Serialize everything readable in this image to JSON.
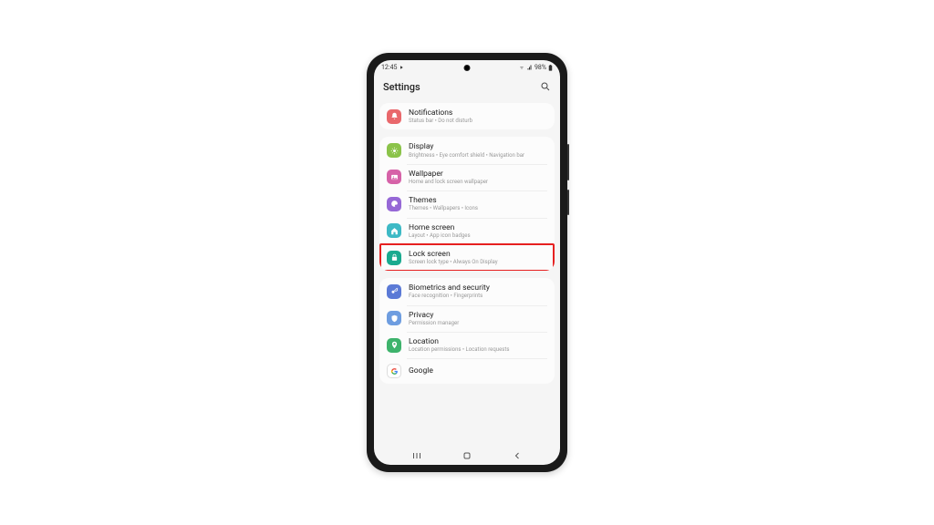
{
  "status": {
    "time": "12:45",
    "battery": "98%"
  },
  "header": {
    "title": "Settings"
  },
  "groups": [
    {
      "items": [
        {
          "id": "notifications",
          "title": "Notifications",
          "sub": "Status bar  •  Do not disturb",
          "icon": "bell",
          "color": "#e9686c"
        }
      ]
    },
    {
      "items": [
        {
          "id": "display",
          "title": "Display",
          "sub": "Brightness  •  Eye comfort shield  •  Navigation bar",
          "icon": "sun",
          "color": "#8bc34a"
        },
        {
          "id": "wallpaper",
          "title": "Wallpaper",
          "sub": "Home and lock screen wallpaper",
          "icon": "image",
          "color": "#d662a8"
        },
        {
          "id": "themes",
          "title": "Themes",
          "sub": "Themes  •  Wallpapers  •  Icons",
          "icon": "palette",
          "color": "#9668d6"
        },
        {
          "id": "homescreen",
          "title": "Home screen",
          "sub": "Layout  •  App icon badges",
          "icon": "home",
          "color": "#3db9c5"
        },
        {
          "id": "lockscreen",
          "title": "Lock screen",
          "sub": "Screen lock type  •  Always On Display",
          "icon": "lock",
          "color": "#1aaa8f",
          "highlighted": true
        }
      ]
    },
    {
      "items": [
        {
          "id": "biometrics",
          "title": "Biometrics and security",
          "sub": "Face recognition  •  Fingerprints",
          "icon": "key",
          "color": "#5b7ad6"
        },
        {
          "id": "privacy",
          "title": "Privacy",
          "sub": "Permission manager",
          "icon": "shield",
          "color": "#6e9de0"
        },
        {
          "id": "location",
          "title": "Location",
          "sub": "Location permissions  •  Location requests",
          "icon": "pin",
          "color": "#3eb36c"
        },
        {
          "id": "google",
          "title": "Google",
          "sub": "",
          "icon": "google",
          "color": "#ffffff"
        }
      ]
    }
  ]
}
